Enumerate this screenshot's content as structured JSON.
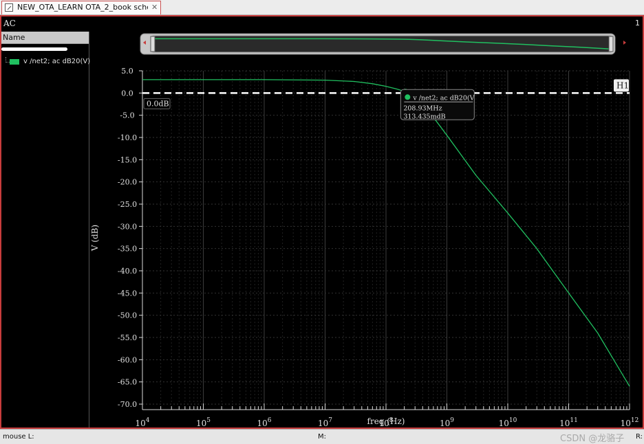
{
  "tab": {
    "title": "NEW_OTA_LEARN OTA_2_book schem...",
    "close": "✕"
  },
  "window": {
    "title": "AC",
    "number": "1"
  },
  "sidebar": {
    "header": "Name"
  },
  "legend": {
    "label": "v /net2; ac dB20(V)",
    "color": "#20c060"
  },
  "marker": {
    "name": "H1",
    "value_label": "0.0dB",
    "tooltip_title": "v /net2; ac dB20(V",
    "tooltip_freq": "208.93MHz",
    "tooltip_value": "313.435mdB",
    "freq_hz": 208930000,
    "value_db": 0.313
  },
  "status": {
    "mouse_l": "mouse L:",
    "mouse_m": "M:",
    "mouse_r": "R:"
  },
  "watermark": "CSDN @龙骆子",
  "chart_data": {
    "type": "line",
    "xlabel": "freq (Hz)",
    "ylabel": "V (dB)",
    "x_scale": "log",
    "xlim": [
      10000,
      1000000000000
    ],
    "ylim": [
      -70,
      5
    ],
    "x_tick_exponents": [
      4,
      5,
      6,
      7,
      8,
      9,
      10,
      11,
      12
    ],
    "y_ticks": [
      "5.0",
      "0.0",
      "-5.0",
      "-10.0",
      "-15.0",
      "-20.0",
      "-25.0",
      "-30.0",
      "-35.0",
      "-40.0",
      "-45.0",
      "-50.0",
      "-55.0",
      "-60.0",
      "-65.0",
      "-70.0"
    ],
    "grid": true,
    "series": [
      {
        "name": "v /net2; ac dB20(V)",
        "color": "#20c060",
        "x": [
          10000,
          100000,
          1000000,
          10000000,
          30000000,
          60000000,
          100000000,
          150000000,
          208930000,
          300000000,
          500000000,
          1000000000,
          3000000000,
          10000000000,
          30000000000,
          100000000000,
          300000000000,
          1000000000000
        ],
        "y": [
          3.0,
          3.0,
          3.0,
          2.9,
          2.6,
          2.1,
          1.5,
          0.9,
          0.31,
          -1.3,
          -4.0,
          -9.5,
          -18.5,
          -27.0,
          -35.0,
          -45.0,
          -54.0,
          -66.0
        ]
      }
    ]
  }
}
